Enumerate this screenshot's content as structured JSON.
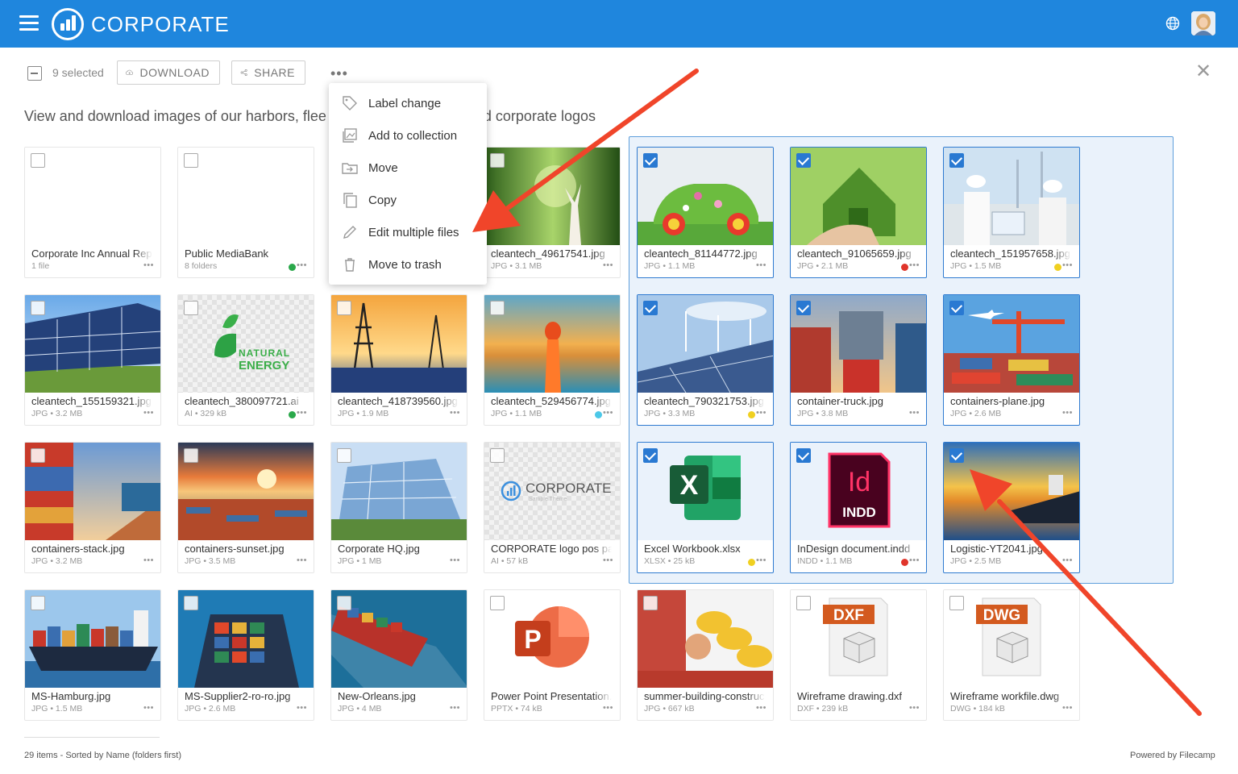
{
  "header": {
    "brand": "CORPORATE"
  },
  "toolbar": {
    "selected_count": "9 selected",
    "download_label": "DOWNLOAD",
    "share_label": "SHARE",
    "more": "•••"
  },
  "subtitle": {
    "left": "View and download images of our harbors, flee",
    "right": "d corporate logos"
  },
  "menu": {
    "items": [
      {
        "label": "Label change",
        "icon": "tag-icon"
      },
      {
        "label": "Add to collection",
        "icon": "collection-icon"
      },
      {
        "label": "Move",
        "icon": "move-icon"
      },
      {
        "label": "Copy",
        "icon": "copy-icon"
      },
      {
        "label": "Edit multiple files",
        "icon": "pencil-icon"
      },
      {
        "label": "Move to trash",
        "icon": "trash-icon"
      }
    ]
  },
  "files": [
    {
      "name": "Corporate Inc Annual Report",
      "meta": "1 file",
      "dots": "•••",
      "selected": false,
      "label_color": "",
      "thumb": "folder"
    },
    {
      "name": "Public MediaBank",
      "meta": "8 folders",
      "dots": "•••",
      "selected": false,
      "label_color": "#2aa84a",
      "thumb": "folder"
    },
    {
      "name": "cleantech_49617541.jpg",
      "meta": "JPG • 3.1 MB",
      "dots": "•••",
      "selected": false,
      "label_color": "",
      "thumb": "forest"
    },
    {
      "name": "cleantech_81144772.jpg",
      "meta": "JPG • 1.1 MB",
      "dots": "•••",
      "selected": true,
      "label_color": "",
      "thumb": "greencar"
    },
    {
      "name": "cleantech_91065659.jpg",
      "meta": "JPG • 2.1 MB",
      "dots": "•••",
      "selected": true,
      "label_color": "#e0352b",
      "thumb": "greenhouse"
    },
    {
      "name": "cleantech_151957658.jpg",
      "meta": "JPG • 1.5 MB",
      "dots": "•••",
      "selected": true,
      "label_color": "#f0d020",
      "thumb": "engineers"
    },
    {
      "name": "cleantech_155159321.jpg",
      "meta": "JPG • 3.2 MB",
      "dots": "•••",
      "selected": false,
      "label_color": "",
      "thumb": "solar"
    },
    {
      "name": "cleantech_380097721.ai",
      "meta": "AI • 329 kB",
      "dots": "•••",
      "selected": false,
      "label_color": "#2aa84a",
      "thumb": "natural"
    },
    {
      "name": "cleantech_418739560.jpg",
      "meta": "JPG • 1.9 MB",
      "dots": "•••",
      "selected": false,
      "label_color": "",
      "thumb": "pylon"
    },
    {
      "name": "cleantech_529456774.jpg",
      "meta": "JPG • 1.1 MB",
      "dots": "•••",
      "selected": false,
      "label_color": "#4cc8e8",
      "thumb": "cyclist"
    },
    {
      "name": "cleantech_790321753.jpg",
      "meta": "JPG • 3.3 MB",
      "dots": "•••",
      "selected": true,
      "label_color": "#f0d020",
      "thumb": "windsolar"
    },
    {
      "name": "container-truck.jpg",
      "meta": "JPG • 3.8 MB",
      "dots": "•••",
      "selected": true,
      "label_color": "",
      "thumb": "truck"
    },
    {
      "name": "containers-plane.jpg",
      "meta": "JPG • 2.6 MB",
      "dots": "•••",
      "selected": true,
      "label_color": "",
      "thumb": "plane"
    },
    {
      "name": "containers-stack.jpg",
      "meta": "JPG • 3.2 MB",
      "dots": "•••",
      "selected": false,
      "label_color": "",
      "thumb": "stack"
    },
    {
      "name": "containers-sunset.jpg",
      "meta": "JPG • 3.5 MB",
      "dots": "•••",
      "selected": false,
      "label_color": "",
      "thumb": "sunset"
    },
    {
      "name": "Corporate HQ.jpg",
      "meta": "JPG • 1 MB",
      "dots": "•••",
      "selected": false,
      "label_color": "",
      "thumb": "hq"
    },
    {
      "name": "CORPORATE logo pos payoff.ai",
      "meta": "AI • 57 kB",
      "dots": "•••",
      "selected": false,
      "label_color": "",
      "thumb": "logo"
    },
    {
      "name": "Excel Workbook.xlsx",
      "meta": "XLSX • 25 kB",
      "dots": "•••",
      "selected": true,
      "label_color": "#f0d020",
      "thumb": "excel"
    },
    {
      "name": "InDesign document.indd",
      "meta": "INDD • 1.1 MB",
      "dots": "•••",
      "selected": true,
      "label_color": "#e0352b",
      "thumb": "indd"
    },
    {
      "name": "Logistic-YT2041.jpg",
      "meta": "JPG • 2.5 MB",
      "dots": "•••",
      "selected": true,
      "label_color": "",
      "thumb": "ship"
    },
    {
      "name": "MS-Hamburg.jpg",
      "meta": "JPG • 1.5 MB",
      "dots": "•••",
      "selected": false,
      "label_color": "",
      "thumb": "hamburg"
    },
    {
      "name": "MS-Supplier2-ro-ro.jpg",
      "meta": "JPG • 2.6 MB",
      "dots": "•••",
      "selected": false,
      "label_color": "",
      "thumb": "supplier"
    },
    {
      "name": "New-Orleans.jpg",
      "meta": "JPG • 4 MB",
      "dots": "•••",
      "selected": false,
      "label_color": "",
      "thumb": "orleans"
    },
    {
      "name": "Power Point Presentation.pptx",
      "meta": "PPTX • 74 kB",
      "dots": "•••",
      "selected": false,
      "label_color": "",
      "thumb": "pptx"
    },
    {
      "name": "summer-building-construction.jpg",
      "meta": "JPG • 667 kB",
      "dots": "•••",
      "selected": false,
      "label_color": "",
      "thumb": "helmets"
    },
    {
      "name": "Wireframe drawing.dxf",
      "meta": "DXF • 239 kB",
      "dots": "•••",
      "selected": false,
      "label_color": "",
      "thumb": "dxf"
    },
    {
      "name": "Wireframe workfile.dwg",
      "meta": "DWG • 184 kB",
      "dots": "•••",
      "selected": false,
      "label_color": "",
      "thumb": "dwg"
    }
  ],
  "thumb_text": {
    "natural_line1": "NATURAL",
    "natural_line2": "ENERGY",
    "excel_letter": "X",
    "indd_letters": "Id",
    "indd_label": "INDD",
    "pptx_letter": "P",
    "dxf_label": "DXF",
    "dwg_label": "DWG",
    "logo_text": "CORPORATE",
    "logo_sub": "Sample Theme"
  },
  "footer": {
    "summary": "29 items - Sorted by Name (folders first)",
    "powered": "Powered by Filecamp"
  },
  "colors": {
    "header_bg": "#1f86dd",
    "selection": "#2979d2",
    "annotation_arrow": "#f0452a"
  }
}
